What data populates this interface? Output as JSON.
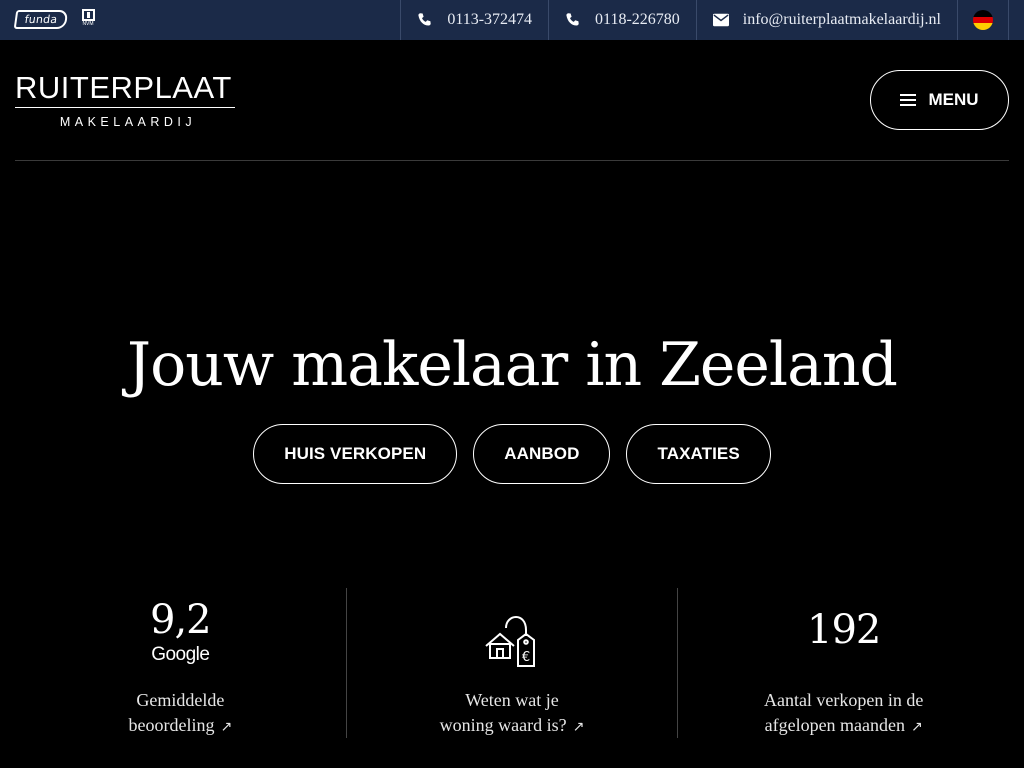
{
  "topbar": {
    "funda_label": "funda",
    "nvm_label": "NVM",
    "phone1": "0113-372474",
    "phone2": "0118-226780",
    "email": "info@ruiterplaatmakelaardij.nl",
    "language_flag_colors": [
      "#000000",
      "#dd0000",
      "#ffce00"
    ]
  },
  "header": {
    "logo_main": "RUITERPLAAT",
    "logo_sub": "MAKELAARDIJ",
    "menu_label": "MENU"
  },
  "hero": {
    "title": "Jouw makelaar in Zeeland",
    "buttons": [
      "HUIS VERKOPEN",
      "AANBOD",
      "TAXATIES"
    ]
  },
  "stats": [
    {
      "value": "9,2",
      "brand": "Google",
      "caption_line1": "Gemiddelde",
      "caption_line2": "beoordeling"
    },
    {
      "icon": "house-price-tag-icon",
      "caption_line1": "Weten wat je",
      "caption_line2": "woning waard is?"
    },
    {
      "value": "192",
      "caption_line1": "Aantal verkopen in de",
      "caption_line2": "afgelopen maanden"
    }
  ],
  "colors": {
    "topbar_bg": "#1b2a48",
    "page_bg": "#000000",
    "text": "#ffffff"
  }
}
